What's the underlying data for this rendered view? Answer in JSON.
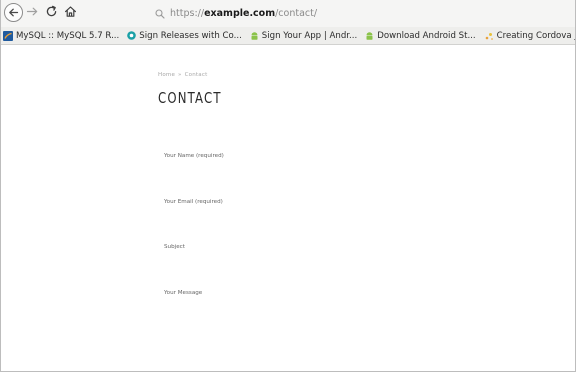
{
  "browser": {
    "url_prefix": "https://",
    "url_host": "example.com",
    "url_path": "/contact/",
    "icons": {
      "back": "back-arrow-icon",
      "forward": "forward-arrow-icon",
      "reload": "reload-icon",
      "home": "home-icon",
      "search": "search-icon"
    }
  },
  "bookmarks": [
    {
      "label": "MySQL :: MySQL 5.7 R...",
      "icon": "mysql-bookmark-icon",
      "color": "#1f5a9e"
    },
    {
      "label": "Sign Releases with Co...",
      "icon": "cordova-bookmark-icon",
      "color": "#1aa0a6"
    },
    {
      "label": "Sign Your App | Andr...",
      "icon": "android-bookmark-icon",
      "color": "#8bc34a"
    },
    {
      "label": "Download Android St...",
      "icon": "android-bookmark-icon",
      "color": "#8bc34a"
    },
    {
      "label": "Creating Cordova jQ...",
      "icon": "sparkle-bookmark-icon",
      "color": "#e8a23a"
    },
    {
      "label": "",
      "icon": "folder-bookmark-icon",
      "color": "#e8c23a"
    }
  ],
  "page": {
    "breadcrumb": {
      "home": "Home",
      "separator": "»",
      "current": "Contact"
    },
    "title": "CONTACT",
    "form": {
      "name_label": "Your Name (required)",
      "email_label": "Your Email (required)",
      "subject_label": "Subject",
      "message_label": "Your Message"
    }
  }
}
